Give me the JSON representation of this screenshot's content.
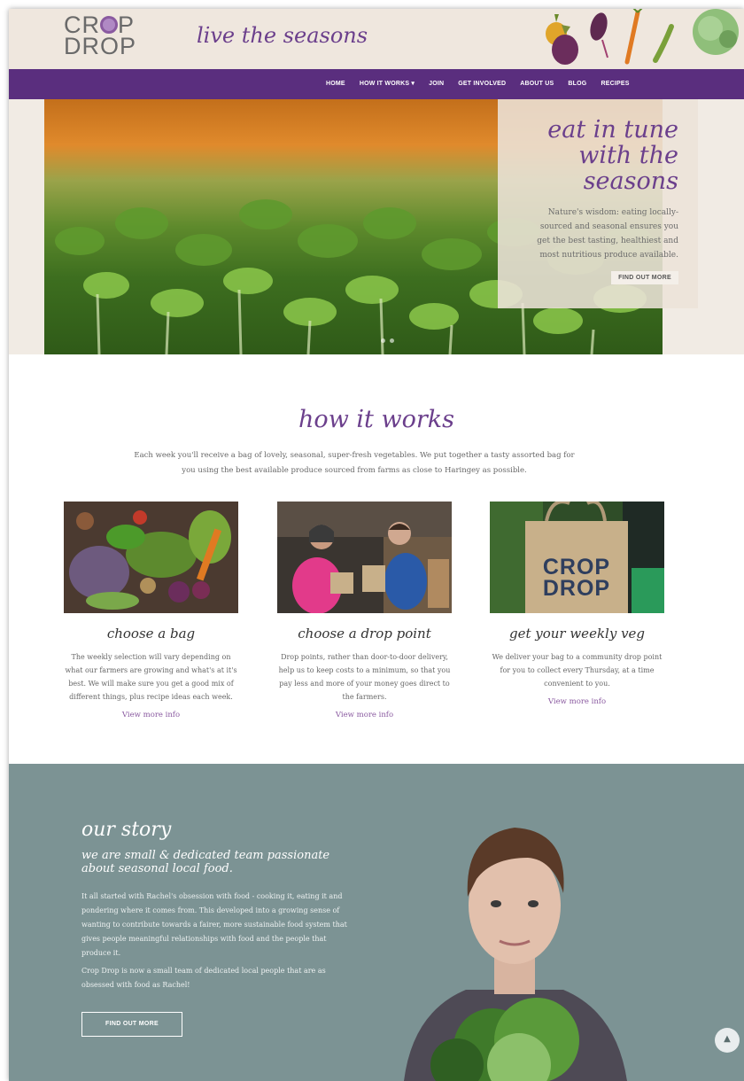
{
  "brand": {
    "logo_line1": "CR",
    "logo_line1b": "P",
    "logo_line2": "DROP",
    "tagline": "live the seasons"
  },
  "nav": {
    "items": [
      "HOME",
      "HOW IT WORKS ▾",
      "JOIN",
      "GET INVOLVED",
      "ABOUT US",
      "BLOG",
      "RECIPES"
    ]
  },
  "hero": {
    "title_line1": "eat in tune",
    "title_line2": "with the",
    "title_line3": "seasons",
    "text": "Nature's wisdom: eating locally-sourced and seasonal ensures you get the best tasting, healthiest and most nutritious produce available.",
    "button": "FIND OUT MORE"
  },
  "how": {
    "title": "how it works",
    "intro": "Each week you'll receive a bag of lovely, seasonal, super-fresh vegetables. We put together a tasty assorted bag for you using the best available produce sourced from farms as close to Haringey as possible.",
    "steps": [
      {
        "title": "choose a bag",
        "text": "The weekly selection will vary depending on what our farmers are growing and what's at it's best. We will make sure you get a good mix of different things, plus recipe ideas each week.",
        "link": "View more info"
      },
      {
        "title": "choose a drop point",
        "text": "Drop points, rather than door-to-door delivery, help us to keep costs to a minimum, so that you pay less and more of your money goes direct to the farmers.",
        "link": "View more info"
      },
      {
        "title": "get your weekly veg",
        "text": "We deliver your bag to a community drop point for you to collect every Thursday, at a time convenient to you.",
        "link": "View more info"
      }
    ],
    "bag_logo_line1": "CROP",
    "bag_logo_line2": "DROP"
  },
  "story": {
    "title": "our story",
    "subtitle": "we are small & dedicated team passionate about seasonal local food.",
    "p1": "It all started with Rachel's obsession with food - cooking it, eating it and pondering where it comes from. This developed into a growing sense of wanting to contribute towards a fairer, more sustainable food system that gives people meaningful relationships with food and the people that produce it.",
    "p2": "Crop Drop is now a small team of dedicated local people that are as obsessed with food as Rachel!",
    "button": "FIND OUT MORE"
  },
  "colors": {
    "purple": "#5a2e7e",
    "accent_purple": "#6b3f8c",
    "story_bg": "#7c9394",
    "header_bg": "#efe7de"
  },
  "icons": {
    "scroll_top": "chevron-up-icon"
  }
}
